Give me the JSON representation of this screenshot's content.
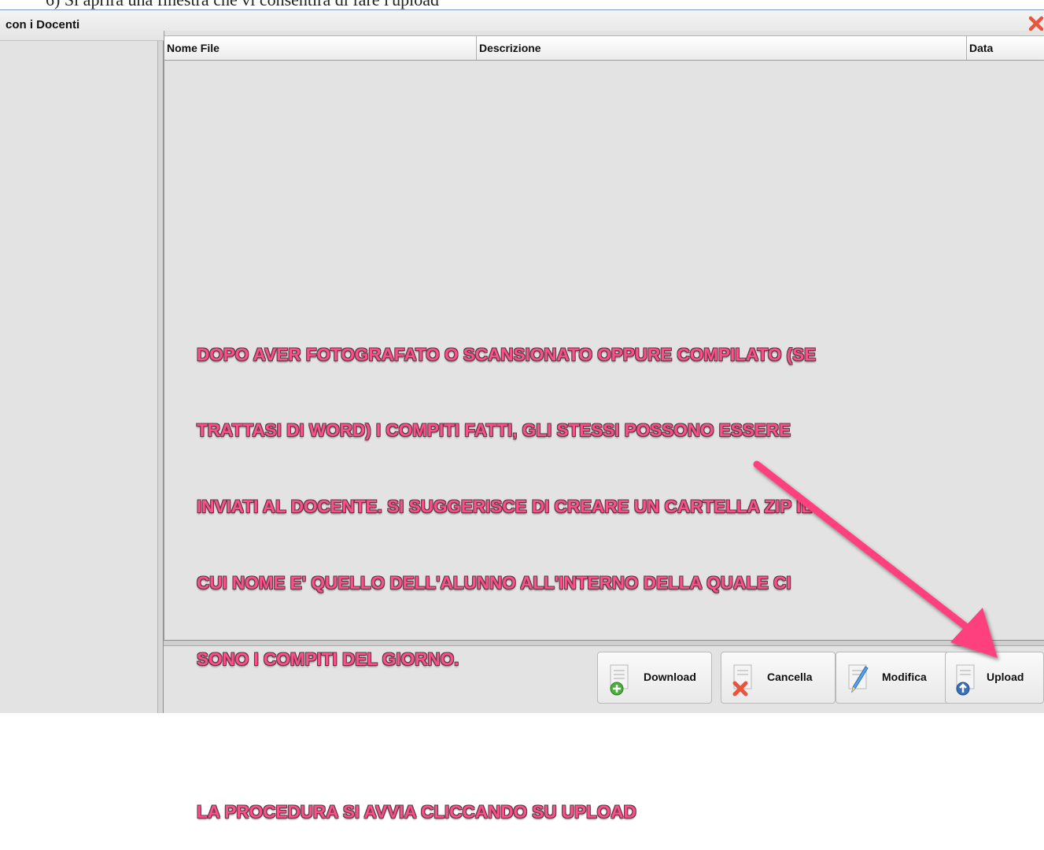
{
  "document": {
    "text": "6)   Si aprirà una finestra che vi consentirà di fare l'upload"
  },
  "window": {
    "title": "con i Docenti",
    "close_icon": "close-icon"
  },
  "table": {
    "columns": [
      "Nome File",
      "Descrizione",
      "Data"
    ],
    "rows": []
  },
  "buttons": [
    {
      "label": "Download",
      "icon": "download-icon"
    },
    {
      "label": "Cancella",
      "icon": "delete-icon"
    },
    {
      "label": "Modifica",
      "icon": "edit-icon"
    },
    {
      "label": "Upload",
      "icon": "upload-icon"
    }
  ],
  "annotation": {
    "lines": [
      "DOPO AVER FOTOGRAFATO O SCANSIONATO OPPURE COMPILATO (SE",
      "TRATTASI DI WORD) I COMPITI FATTI, GLI STESSI POSSONO ESSERE",
      "INVIATI AL DOCENTE. SI SUGGERISCE DI CREARE UN CARTELLA ZIP IL",
      "CUI NOME E' QUELLO DELL'ALUNNO ALL'INTERNO DELLA QUALE CI",
      "SONO I COMPITI DEL GIORNO."
    ],
    "instruction": "LA PROCEDURA SI AVVIA CLICCANDO SU UPLOAD",
    "color": "#ff4f8a"
  }
}
